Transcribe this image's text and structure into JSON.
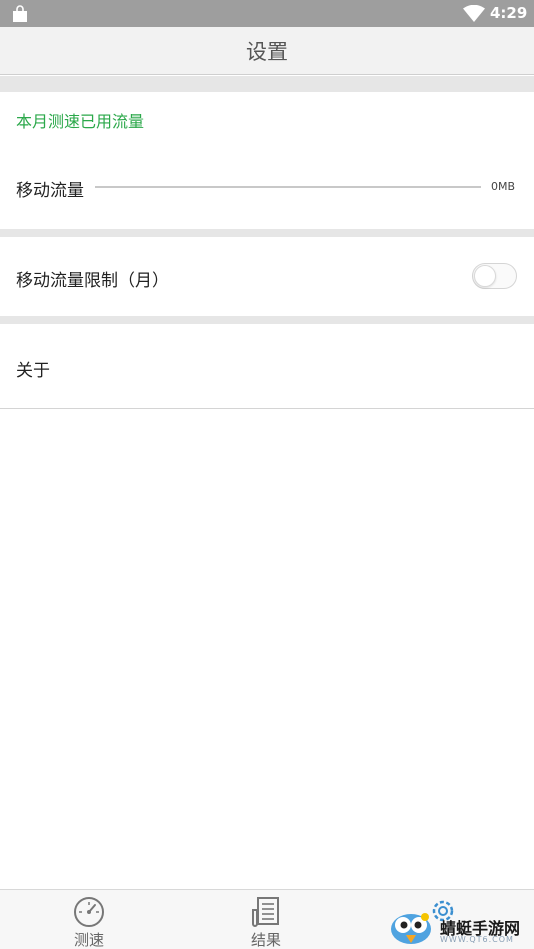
{
  "status_bar": {
    "time": "4:29"
  },
  "app_bar": {
    "title": "设置"
  },
  "data_usage": {
    "section_title": "本月测速已用流量",
    "mobile_label": "移动流量",
    "mobile_value": "0MB",
    "used_fraction": 0
  },
  "limit": {
    "label": "移动流量限制（月）",
    "enabled": false
  },
  "about": {
    "label": "关于"
  },
  "bottom_nav": {
    "items": [
      {
        "label": "测速"
      },
      {
        "label": "结果"
      }
    ]
  },
  "watermark": {
    "text": "蜻蜓手游网",
    "url": "WWW.QT6.COM"
  },
  "colors": {
    "accent": "#2ba84a",
    "status_bar": "#9e9e9e",
    "app_bar": "#f2f2f2",
    "section_gap": "#e6e6e6"
  }
}
